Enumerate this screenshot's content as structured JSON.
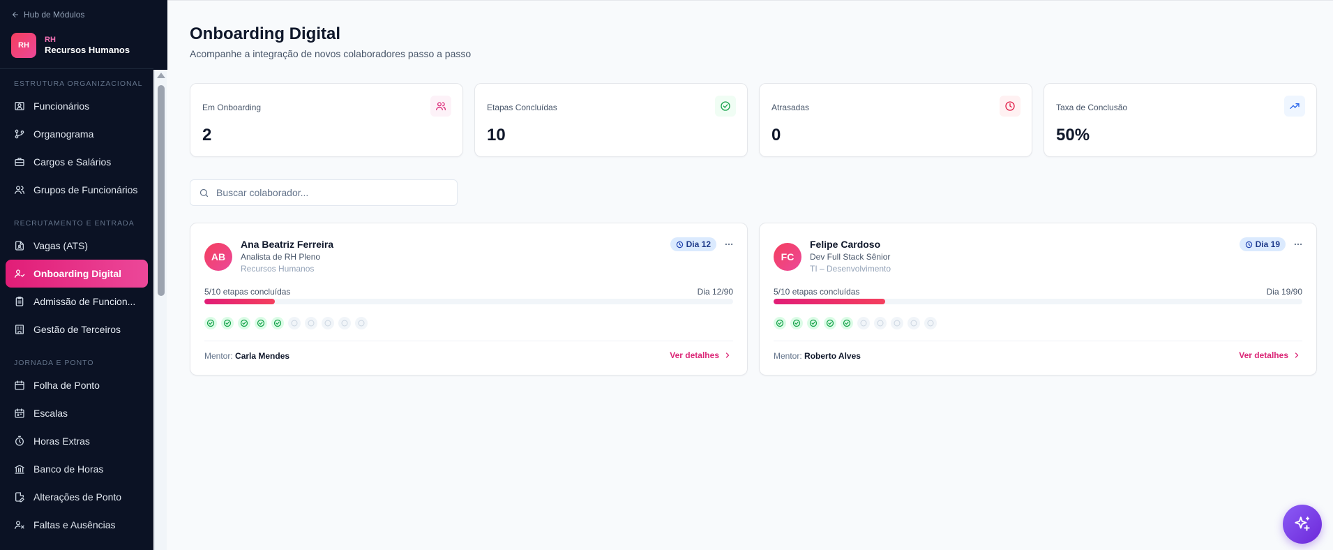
{
  "sidebar": {
    "hub_link": "Hub de Módulos",
    "brand": {
      "logo": "RH",
      "tag": "RH",
      "name": "Recursos Humanos"
    },
    "sections": [
      {
        "title": "ESTRUTURA ORGANIZACIONAL",
        "items": [
          {
            "label": "Funcionários",
            "icon": "id-card-icon"
          },
          {
            "label": "Organograma",
            "icon": "git-branch-icon"
          },
          {
            "label": "Cargos e Salários",
            "icon": "briefcase-icon"
          },
          {
            "label": "Grupos de Funcionários",
            "icon": "users-icon"
          }
        ]
      },
      {
        "title": "RECRUTAMENTO E ENTRADA",
        "items": [
          {
            "label": "Vagas (ATS)",
            "icon": "file-user-icon"
          },
          {
            "label": "Onboarding Digital",
            "icon": "user-check-icon",
            "active": true
          },
          {
            "label": "Admissão de Funcion...",
            "icon": "clipboard-icon"
          },
          {
            "label": "Gestão de Terceiros",
            "icon": "building-icon"
          }
        ]
      },
      {
        "title": "JORNADA E PONTO",
        "items": [
          {
            "label": "Folha de Ponto",
            "icon": "calendar-icon"
          },
          {
            "label": "Escalas",
            "icon": "calendar-grid-icon"
          },
          {
            "label": "Horas Extras",
            "icon": "timer-icon"
          },
          {
            "label": "Banco de Horas",
            "icon": "bank-icon"
          },
          {
            "label": "Alterações de Ponto",
            "icon": "file-edit-icon"
          },
          {
            "label": "Faltas e Ausências",
            "icon": "user-x-icon"
          }
        ]
      }
    ]
  },
  "page": {
    "title": "Onboarding Digital",
    "subtitle": "Acompanhe a integração de novos colaboradores passo a passo"
  },
  "stats": [
    {
      "label": "Em Onboarding",
      "value": "2",
      "icon": "users-icon",
      "color": "#db2777",
      "bg": "#fdf2f8"
    },
    {
      "label": "Etapas Concluídas",
      "value": "10",
      "icon": "check-circle-icon",
      "color": "#16a34a",
      "bg": "#f0fdf4"
    },
    {
      "label": "Atrasadas",
      "value": "0",
      "icon": "clock-icon",
      "color": "#e11d48",
      "bg": "#fff1f2"
    },
    {
      "label": "Taxa de Conclusão",
      "value": "50%",
      "icon": "trending-up-icon",
      "color": "#2563eb",
      "bg": "#eff6ff"
    }
  ],
  "search": {
    "placeholder": "Buscar colaborador..."
  },
  "employees": [
    {
      "initials": "AB",
      "name": "Ana Beatriz Ferreira",
      "role": "Analista de RH Pleno",
      "department": "Recursos Humanos",
      "day_badge": "Dia 12",
      "progress_label": "5/10 etapas concluídas",
      "day_progress": "Dia 12/90",
      "progress_fraction": 0.1333,
      "steps_done": 5,
      "steps_total": 10,
      "mentor_label": "Mentor:",
      "mentor": "Carla Mendes",
      "details_label": "Ver detalhes"
    },
    {
      "initials": "FC",
      "name": "Felipe Cardoso",
      "role": "Dev Full Stack Sênior",
      "department": "TI – Desenvolvimento",
      "day_badge": "Dia 19",
      "progress_label": "5/10 etapas concluídas",
      "day_progress": "Dia 19/90",
      "progress_fraction": 0.2111,
      "steps_done": 5,
      "steps_total": 10,
      "mentor_label": "Mentor:",
      "mentor": "Roberto Alves",
      "details_label": "Ver detalhes"
    }
  ],
  "colors": {
    "accent": "#e11d77",
    "sidebar_bg": "#0b1224",
    "fab": "#7c3aed"
  },
  "fab_icon": "sparkles-icon"
}
